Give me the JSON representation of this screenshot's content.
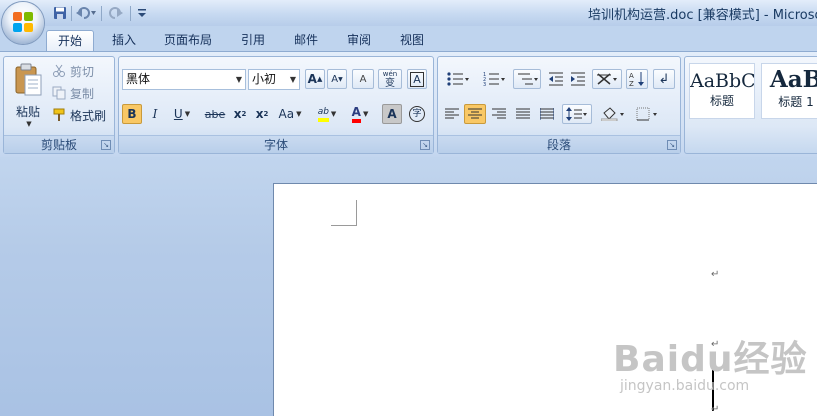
{
  "window": {
    "title": "培训机构运营.doc [兼容模式] - Microsoft"
  },
  "quick_access": {
    "save_icon": "save-icon",
    "undo_icon": "undo-icon",
    "redo_icon": "redo-icon",
    "customize_icon": "chevron-down-icon"
  },
  "tabs": [
    {
      "label": "开始",
      "active": true
    },
    {
      "label": "插入"
    },
    {
      "label": "页面布局"
    },
    {
      "label": "引用"
    },
    {
      "label": "邮件"
    },
    {
      "label": "审阅"
    },
    {
      "label": "视图"
    }
  ],
  "clipboard": {
    "paste_label": "粘贴",
    "cut_label": "剪切",
    "copy_label": "复制",
    "format_painter_label": "格式刷",
    "group_label": "剪贴板"
  },
  "font": {
    "font_name": "黑体",
    "font_size": "小初",
    "grow_font": "A",
    "shrink_font": "A",
    "clear_format": "A",
    "phonetic_guide": "wén",
    "phonetic_char": "变",
    "char_border": "A",
    "bold": "B",
    "italic": "I",
    "underline": "U",
    "strikethrough": "abe",
    "subscript": "x",
    "subscript_mark": "2",
    "superscript": "x",
    "superscript_mark": "2",
    "change_case": "Aa",
    "highlight": "ab",
    "font_color": "A",
    "char_shading": "A",
    "enclose_char": "字",
    "group_label": "字体",
    "colors": {
      "highlight": "#ffff00",
      "font_color": "#ff0000",
      "bold_active": "#f9c865"
    }
  },
  "paragraph": {
    "group_label": "段落"
  },
  "styles": {
    "style1_sample": "AaBbC",
    "style1_label": "标题",
    "style2_sample": "AaB",
    "style2_label": "标题 1"
  },
  "document": {
    "paragraph_marks": [
      "↵",
      "↵",
      "↵"
    ]
  },
  "watermark": {
    "text": "Baidu经验",
    "subtext": "jingyan.baidu.com"
  }
}
